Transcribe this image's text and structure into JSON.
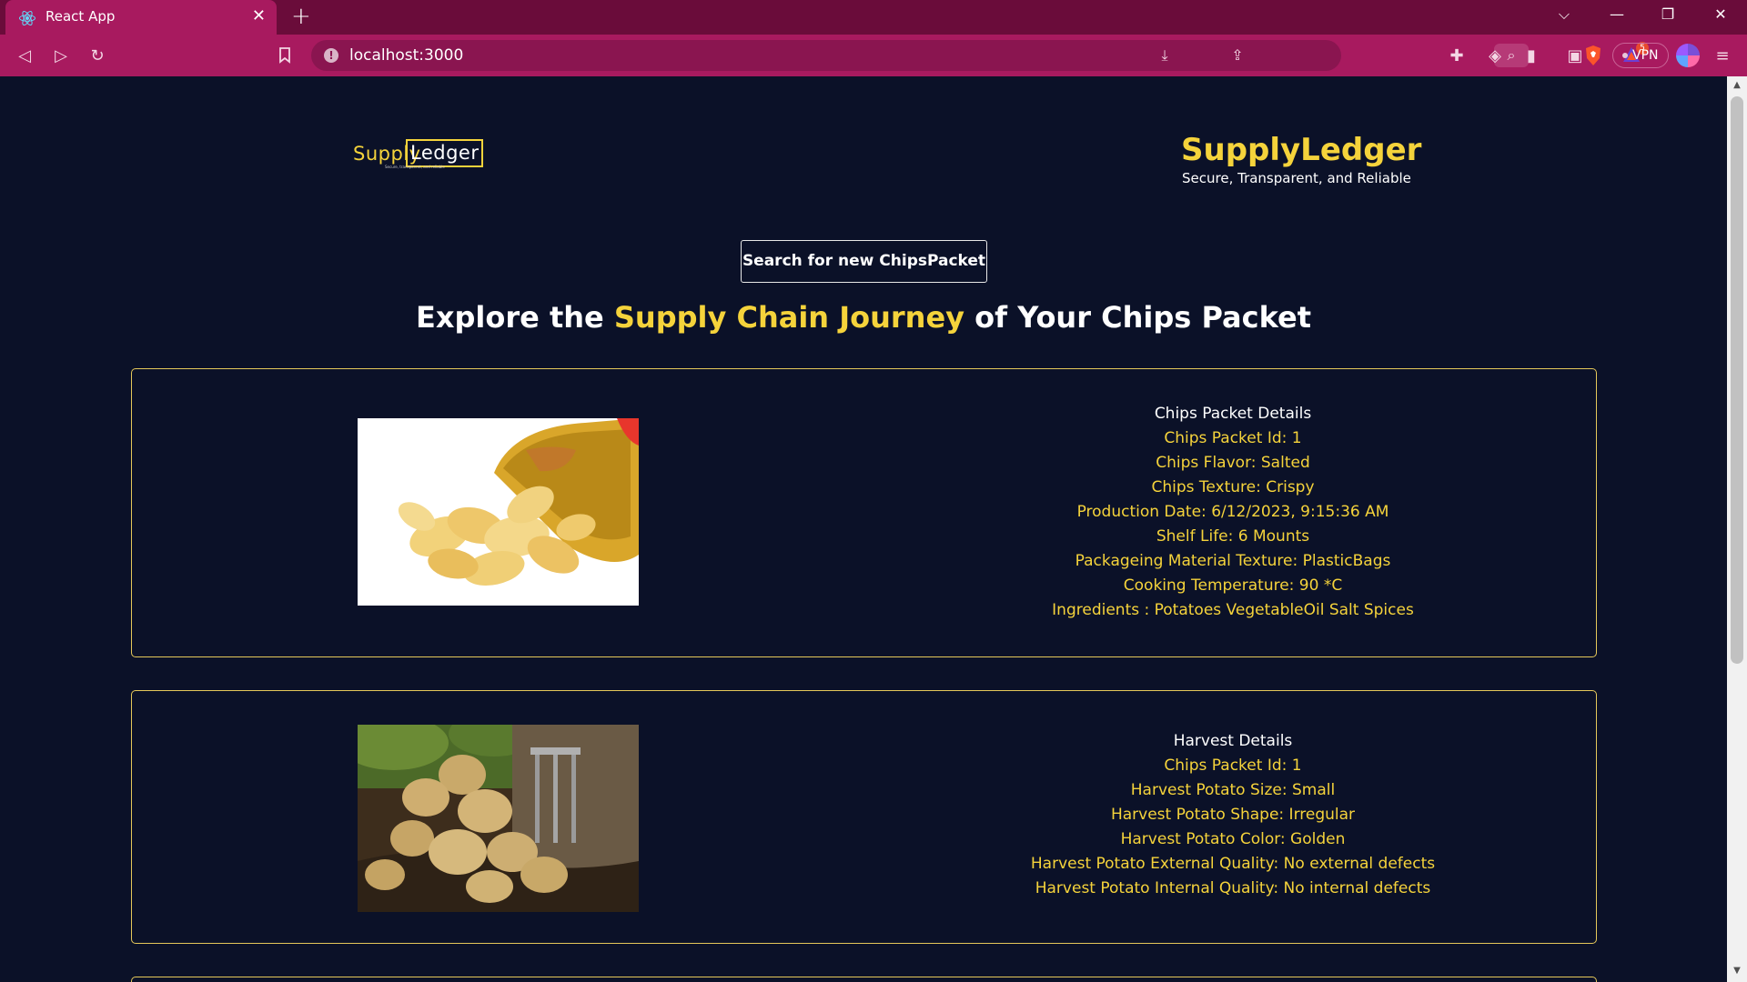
{
  "browser": {
    "tab_title": "React App",
    "url": "localhost:3000",
    "notification_count": "5",
    "vpn_label": "VPN"
  },
  "header": {
    "logo_supply": "Supply",
    "logo_ledger": "Ledger",
    "logo_tagline": "Secure, transparent, and reliable",
    "brand_name": "SupplyLedger",
    "brand_tagline": "Secure, Transparent, and Reliable"
  },
  "search_button": "Search for new ChipsPacket",
  "headline": {
    "pre": "Explore the ",
    "highlight": "Supply Chain Journey",
    "post": " of Your Chips Packet"
  },
  "chips_details": {
    "heading": "Chips Packet Details",
    "lines": [
      "Chips Packet Id: 1",
      "Chips Flavor: Salted",
      "Chips Texture: Crispy",
      "Production Date: 6/12/2023, 9:15:36 AM",
      "Shelf Life: 6 Mounts",
      "Packageing Material Texture: PlasticBags",
      "Cooking Temperature: 90 *C",
      "Ingredients : Potatoes VegetableOil Salt Spices"
    ]
  },
  "harvest_details": {
    "heading": "Harvest Details",
    "lines": [
      "Chips Packet Id: 1",
      "Harvest Potato Size: Small",
      "Harvest Potato Shape: Irregular",
      "Harvest Potato Color: Golden",
      "Harvest Potato External Quality: No external defects",
      "Harvest Potato Internal Quality: No internal defects"
    ]
  },
  "colors": {
    "background": "#0b1128",
    "accent": "#f5d33b",
    "browser_chrome": "#a81a5f"
  }
}
